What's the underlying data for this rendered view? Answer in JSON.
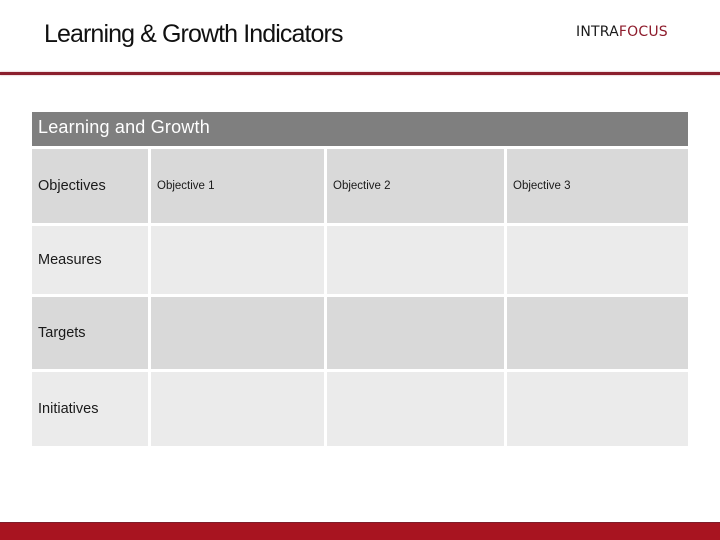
{
  "slide": {
    "title": "Learning & Growth Indicators"
  },
  "brand": {
    "part1": "INTRA",
    "part2": "FOCUS",
    "colors": {
      "part1": "#1a1a1a",
      "part2": "#8e1c2c"
    }
  },
  "theme": {
    "accent": "#8b1f2d",
    "bottom_bar": "#a81420",
    "header_bg": "#7f7f7f",
    "row_dark": "#d9d9d9",
    "row_light": "#ebebeb"
  },
  "table": {
    "header": "Learning and Growth",
    "rows": [
      {
        "label": "Objectives",
        "cells": [
          "Objective 1",
          "Objective 2",
          "Objective 3"
        ]
      },
      {
        "label": "Measures",
        "cells": [
          "",
          "",
          ""
        ]
      },
      {
        "label": "Targets",
        "cells": [
          "",
          "",
          ""
        ]
      },
      {
        "label": "Initiatives",
        "cells": [
          "",
          "",
          ""
        ]
      }
    ]
  }
}
